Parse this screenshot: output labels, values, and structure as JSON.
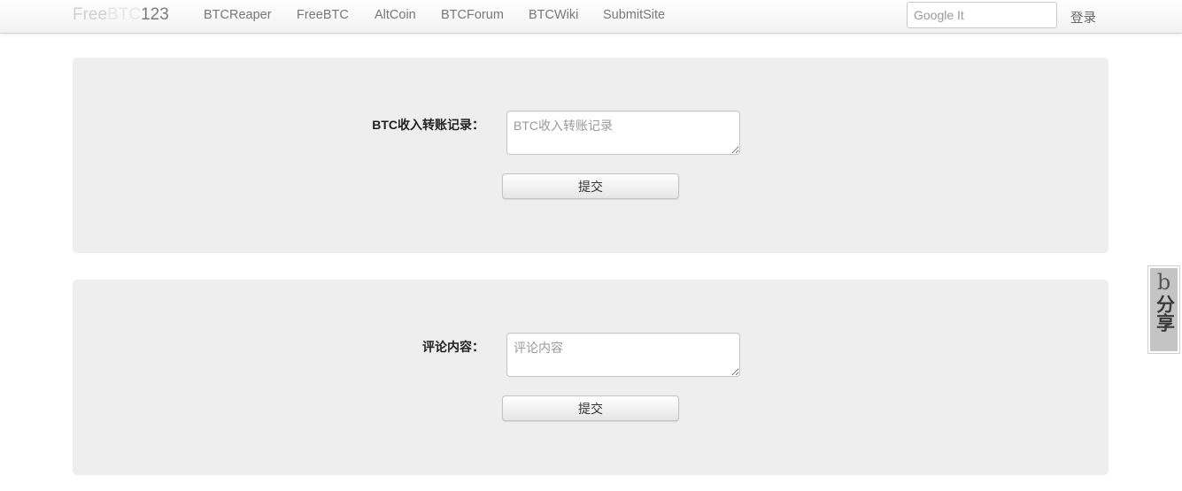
{
  "nav": {
    "brand": {
      "part1": "Free",
      "part2": "BTC",
      "part3": "123"
    },
    "links": [
      "BTCReaper",
      "FreeBTC",
      "AltCoin",
      "BTCForum",
      "BTCWiki",
      "SubmitSite"
    ],
    "search_placeholder": "Google It",
    "login": "登录"
  },
  "forms": [
    {
      "label": "BTC收入转账记录：",
      "placeholder": "BTC收入转账记录",
      "submit": "提交"
    },
    {
      "label": "评论内容：",
      "placeholder": "评论内容",
      "submit": "提交"
    }
  ],
  "share": {
    "icon": "share-icon",
    "text": "分享"
  },
  "colors": {
    "panel_bg": "#eeeeee",
    "nav_bg": "#f5f5f5"
  }
}
